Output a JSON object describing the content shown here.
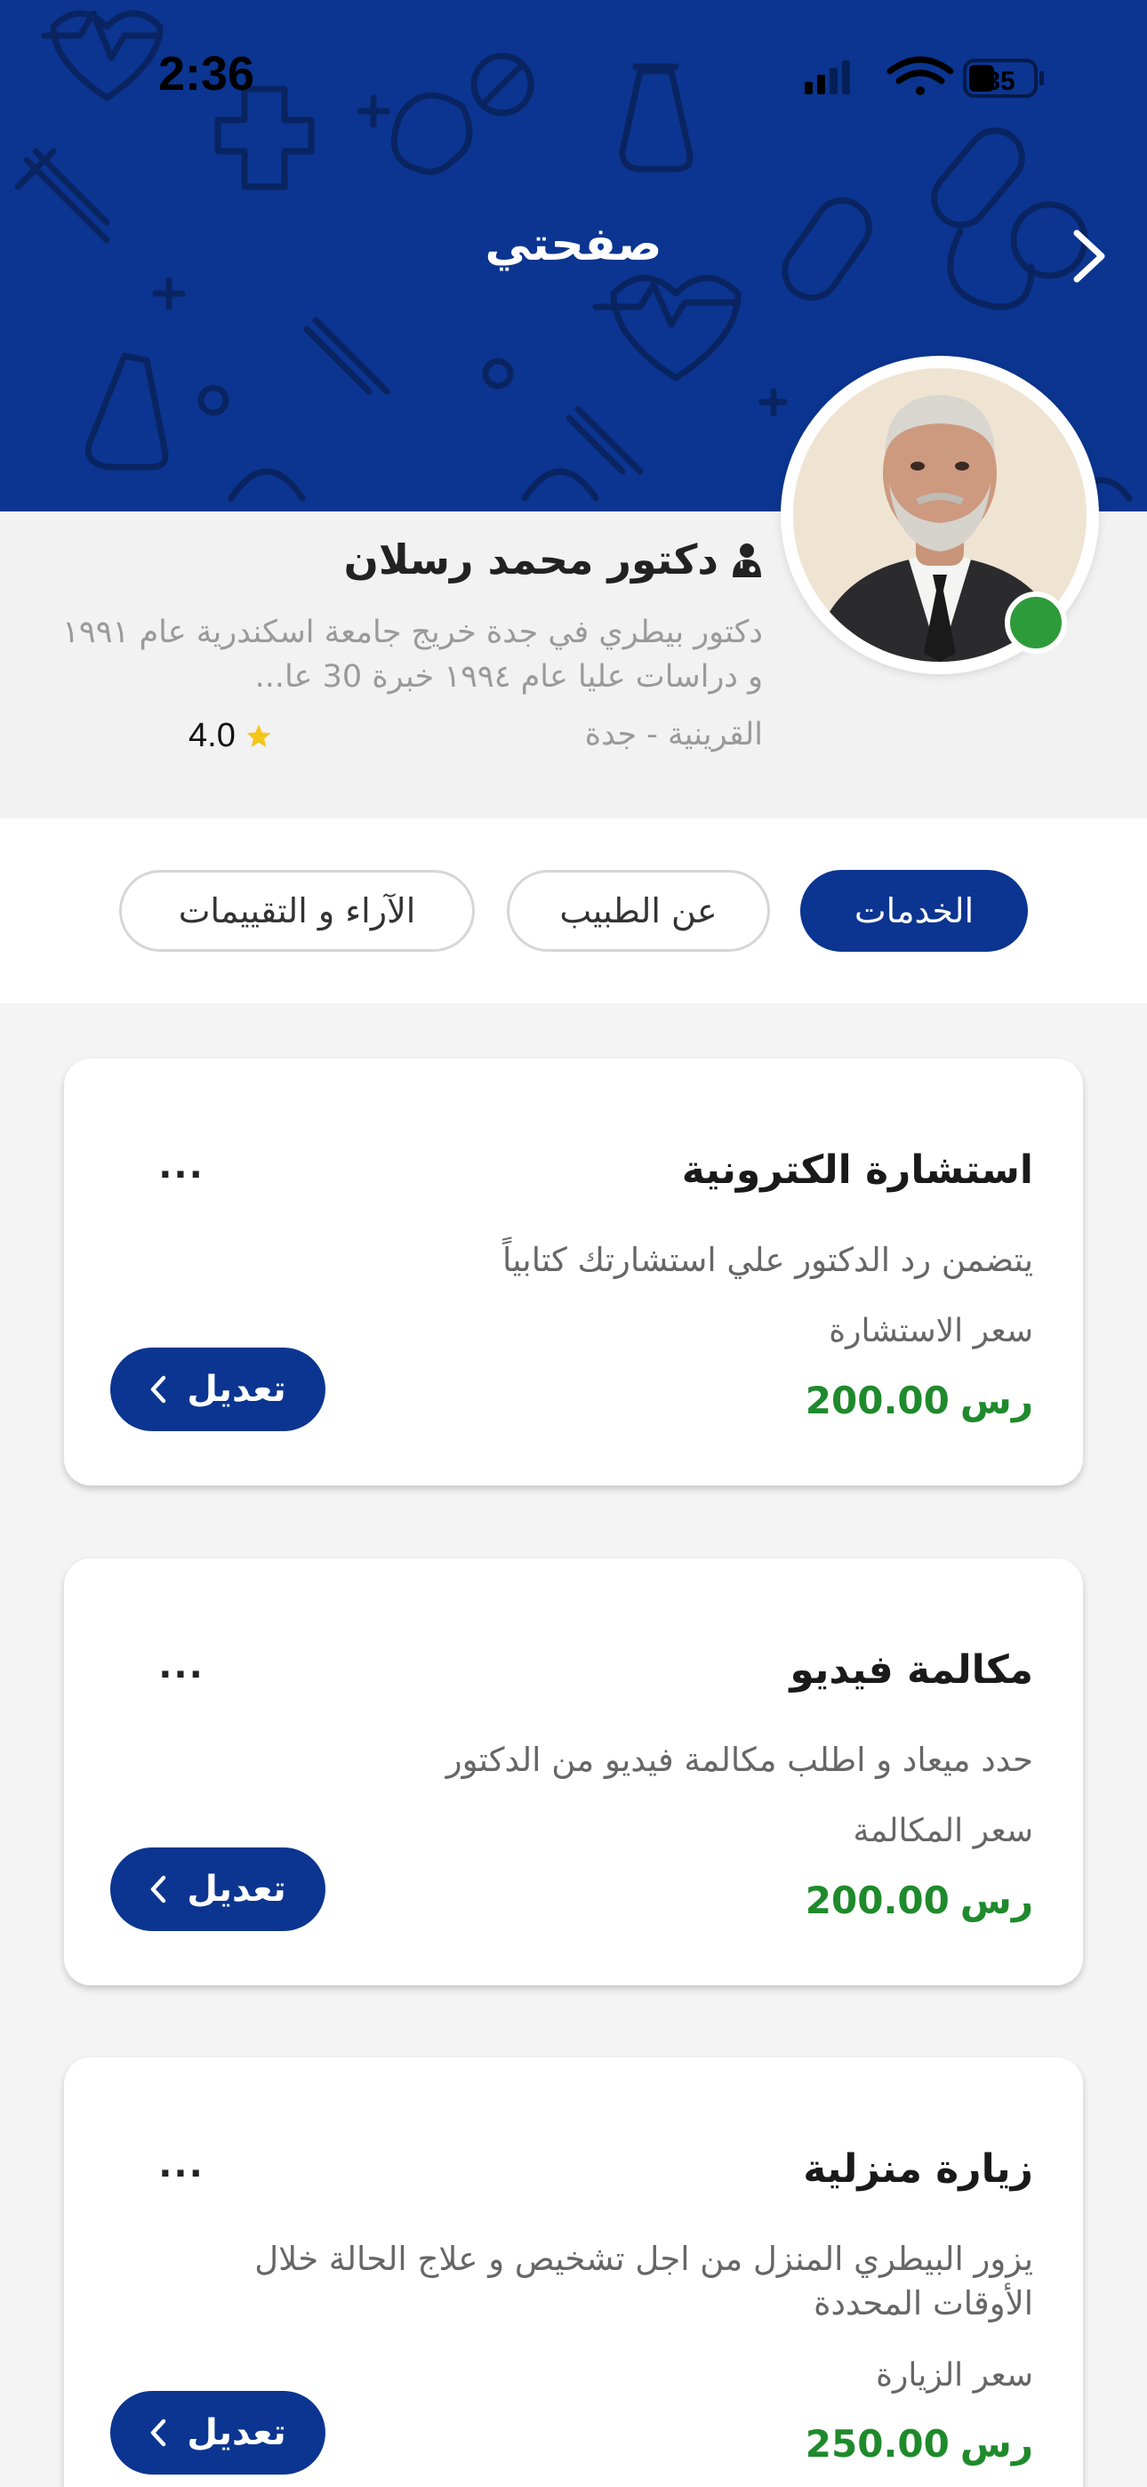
{
  "status_bar": {
    "time": "2:36",
    "battery": "35",
    "icons": [
      "signal-icon",
      "wifi-icon",
      "battery-icon"
    ]
  },
  "header": {
    "title": "صفحتي",
    "back_icon": "chevron-right-icon",
    "background_color": "#0b3590"
  },
  "profile": {
    "name": "دكتور محمد رسلان",
    "name_icon": "doctor-icon",
    "bio": "دكتور بيطري في جدة  خريج جامعة اسكندرية عام ١٩٩١ و دراسات عليا عام ١٩٩٤ خبرة 30 عا...",
    "location": "القرينية - جدة",
    "rating": "4.0",
    "online_status_color": "#2e9b3a"
  },
  "tabs": [
    {
      "label": "الخدمات",
      "active": true
    },
    {
      "label": "عن الطبيب",
      "active": false
    },
    {
      "label": "الآراء و التقييمات",
      "active": false
    }
  ],
  "services": [
    {
      "title": "استشارة الكترونية",
      "more": "...",
      "description": "يتضمن رد الدكتور علي استشارتك كتابياً",
      "price_label": "سعر الاستشارة",
      "price": "200.00",
      "currency": "رس",
      "edit_label": "تعديل"
    },
    {
      "title": "مكالمة فيديو",
      "more": "...",
      "description": "حدد ميعاد و اطلب مكالمة فيديو من الدكتور",
      "price_label": "سعر المكالمة",
      "price": "200.00",
      "currency": "رس",
      "edit_label": "تعديل"
    },
    {
      "title": "زيارة منزلية",
      "more": "...",
      "description": "يزور البيطري المنزل من اجل تشخيص و علاج الحالة خلال الأوقات المحددة",
      "price_label": "سعر الزيارة",
      "price": "250.00",
      "currency": "رس",
      "edit_label": "تعديل"
    }
  ],
  "colors": {
    "primary": "#0b3590",
    "price": "#1f8a2c",
    "star": "#f5c518"
  }
}
